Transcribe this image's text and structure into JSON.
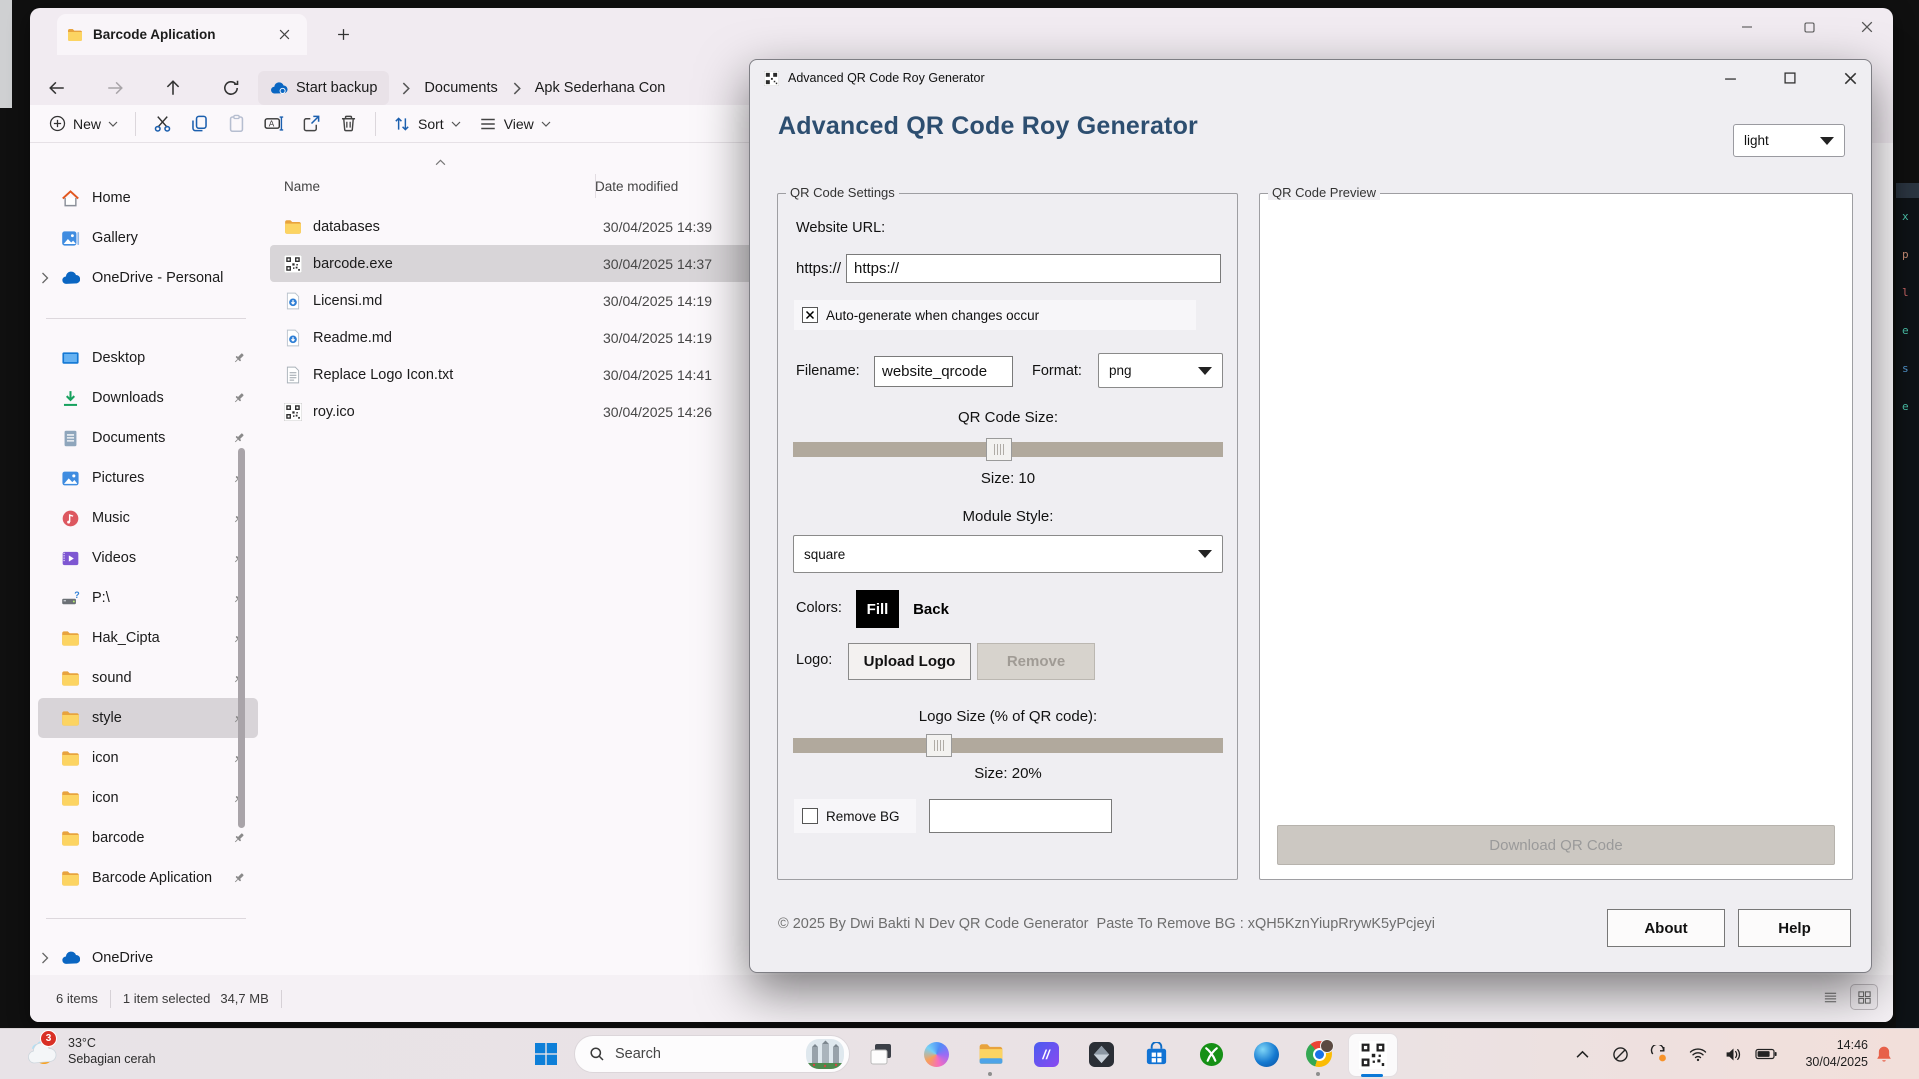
{
  "colors": {
    "accent": "#0b78d7",
    "selection": "#d8d5d8",
    "dialog_bg": "#efeef2",
    "heading": "#2d4e70",
    "slider_trough": "#b1a99d",
    "disabled_text": "#9a9a9a",
    "fill_button_bg": "#000000"
  },
  "explorer": {
    "tab_title": "Barcode Aplication",
    "breadcrumb": {
      "chip": "Start backup",
      "crumb1": "Documents",
      "crumb2": "Apk Sederhana Con"
    },
    "toolbar": {
      "new_label": "New",
      "sort_label": "Sort",
      "view_label": "View"
    },
    "sidebar": {
      "items": [
        {
          "label": "Home",
          "icon": "home"
        },
        {
          "label": "Gallery",
          "icon": "gallery"
        },
        {
          "label": "OneDrive - Personal",
          "icon": "cloud",
          "chevron": true
        },
        {
          "sep": true
        },
        {
          "label": "Desktop",
          "icon": "desktop",
          "pinned": true
        },
        {
          "label": "Downloads",
          "icon": "downloads",
          "pinned": true
        },
        {
          "label": "Documents",
          "icon": "documents",
          "pinned": true
        },
        {
          "label": "Pictures",
          "icon": "pictures",
          "pinned": true
        },
        {
          "label": "Music",
          "icon": "music",
          "pinned": true
        },
        {
          "label": "Videos",
          "icon": "videos",
          "pinned": true
        },
        {
          "label": "P:\\",
          "icon": "drive",
          "pinned": true
        },
        {
          "label": "Hak_Cipta",
          "icon": "folder",
          "pinned": true
        },
        {
          "label": "sound",
          "icon": "folder",
          "pinned": true
        },
        {
          "label": "style",
          "icon": "folder",
          "pinned": true,
          "selected": true
        },
        {
          "label": "icon",
          "icon": "folder",
          "pinned": true
        },
        {
          "label": "icon",
          "icon": "folder",
          "pinned": true
        },
        {
          "label": "barcode",
          "icon": "folder",
          "pinned": true
        },
        {
          "label": "Barcode Aplication",
          "icon": "folder",
          "pinned": true
        },
        {
          "sep": true
        },
        {
          "label": "OneDrive",
          "icon": "cloud",
          "chevron": true
        }
      ]
    },
    "list": {
      "name_col": "Name",
      "date_col": "Date modified",
      "rows": [
        {
          "name": "databases",
          "icon": "folder",
          "date": "30/04/2025 14:39"
        },
        {
          "name": "barcode.exe",
          "icon": "qr",
          "date": "30/04/2025 14:37",
          "selected": true
        },
        {
          "name": "Licensi.md",
          "icon": "md",
          "date": "30/04/2025 14:19"
        },
        {
          "name": "Readme.md",
          "icon": "md",
          "date": "30/04/2025 14:19"
        },
        {
          "name": "Replace Logo Icon.txt",
          "icon": "txt",
          "date": "30/04/2025 14:41"
        },
        {
          "name": "roy.ico",
          "icon": "qr",
          "date": "30/04/2025 14:26"
        }
      ]
    },
    "status": {
      "items": "6 items",
      "selected": "1 item selected",
      "size": "34,7 MB"
    }
  },
  "dialog": {
    "window_title": "Advanced QR Code Roy Generator",
    "heading": "Advanced QR Code Roy Generator",
    "theme_value": "light",
    "settings": {
      "group_label": "QR Code Settings",
      "website_url_label": "Website URL:",
      "url_prefix": "https://",
      "url_value": "https://",
      "autogen_label": "Auto-generate when changes occur",
      "autogen_checked": true,
      "filename_label": "Filename:",
      "filename_value": "website_qrcode",
      "format_label": "Format:",
      "format_value": "png",
      "qr_size_label": "QR Code Size:",
      "qr_size_text": "Size: 10",
      "qr_size_percent": 48,
      "module_style_label": "Module Style:",
      "module_style_value": "square",
      "colors_label": "Colors:",
      "fill_label": "Fill",
      "back_label": "Back",
      "logo_label": "Logo:",
      "upload_logo_label": "Upload Logo",
      "remove_label": "Remove",
      "logo_size_label": "Logo Size (% of QR code):",
      "logo_size_text": "Size: 20%",
      "logo_size_percent": 34,
      "remove_bg_label": "Remove BG",
      "remove_bg_checked": false,
      "remove_bg_value": ""
    },
    "preview": {
      "group_label": "QR Code Preview",
      "download_label": "Download QR Code"
    },
    "footer": {
      "copyright": "© 2025 By Dwi Bakti N Dev QR Code Generator  Paste To Remove BG : xQH5KznYiupRrywK5yPcjeyi",
      "about_label": "About",
      "help_label": "Help"
    }
  },
  "taskbar": {
    "weather": {
      "temp": "33°C",
      "condition": "Sebagian cerah",
      "badge": "3"
    },
    "search_placeholder": "Search",
    "app_icons": [
      "start",
      "task-view",
      "copilot",
      "file-explorer",
      "slashes-app",
      "dark-prism-app",
      "microsoft-store",
      "xbox",
      "edge",
      "chrome",
      "qr-generator-app"
    ],
    "tray_icons": [
      "chevron-up",
      "blocked-circle",
      "sync",
      "wifi",
      "volume",
      "battery",
      "notification-bell"
    ],
    "clock": {
      "time": "14:46",
      "date": "30/04/2025"
    }
  }
}
